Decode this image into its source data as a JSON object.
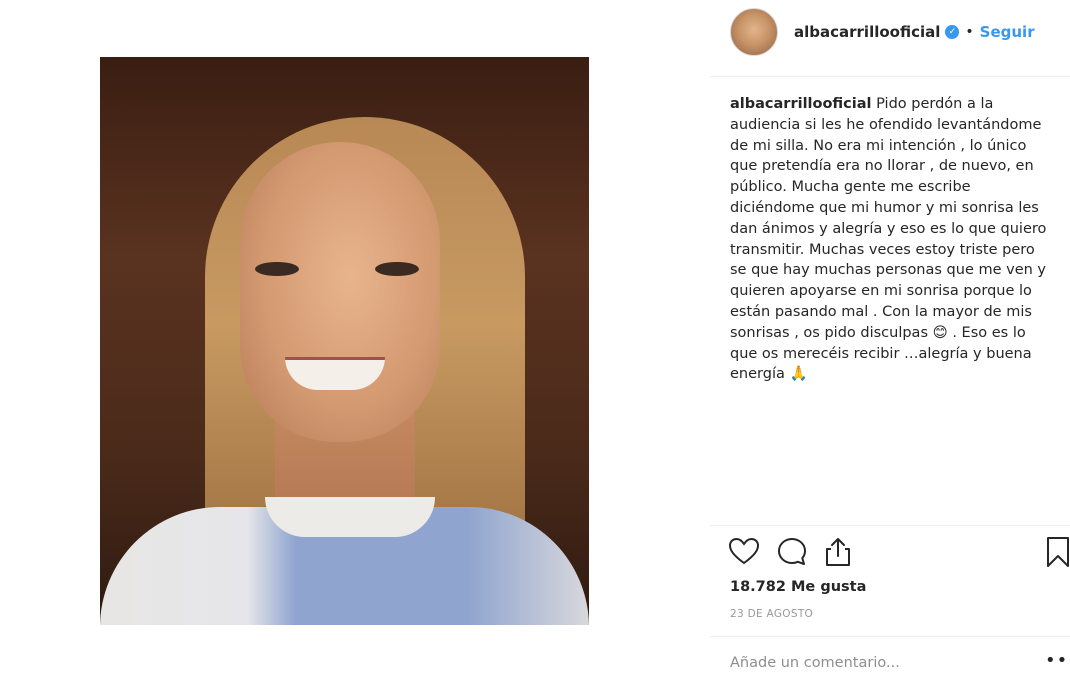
{
  "post": {
    "username": "albacarrillooficial",
    "follow_label": "Seguir",
    "separator": "•",
    "verified_mark": "✓",
    "caption_user": "albacarrillooficial",
    "caption_text": " Pido perdón a la audiencia si les he ofendido levantándome de mi silla. No era mi intención , lo único que pretendía era no llorar , de nuevo, en público. Mucha gente me escribe diciéndome que mi humor y mi sonrisa les dan ánimos y alegría y eso es lo que quiero transmitir. Muchas veces estoy triste pero se que hay muchas personas que me ven y quieren apoyarse en mi sonrisa porque lo están pasando mal . Con la mayor de mis sonrisas , os pido disculpas 😊 . Eso es lo que os merecéis recibir …alegría y buena energía 🙏",
    "likes": "18.782 Me gusta",
    "date": "23 DE AGOSTO",
    "comment_placeholder": "Añade un comentario...",
    "more_label": "•••"
  },
  "icons": {
    "verified": "verified-badge-icon",
    "like": "heart-icon",
    "comment": "comment-bubble-icon",
    "share": "share-icon",
    "save": "bookmark-icon",
    "more": "more-options-icon"
  },
  "colors": {
    "accent": "#3897f0",
    "text": "#262626",
    "muted": "#999999",
    "divider": "#efefef"
  }
}
